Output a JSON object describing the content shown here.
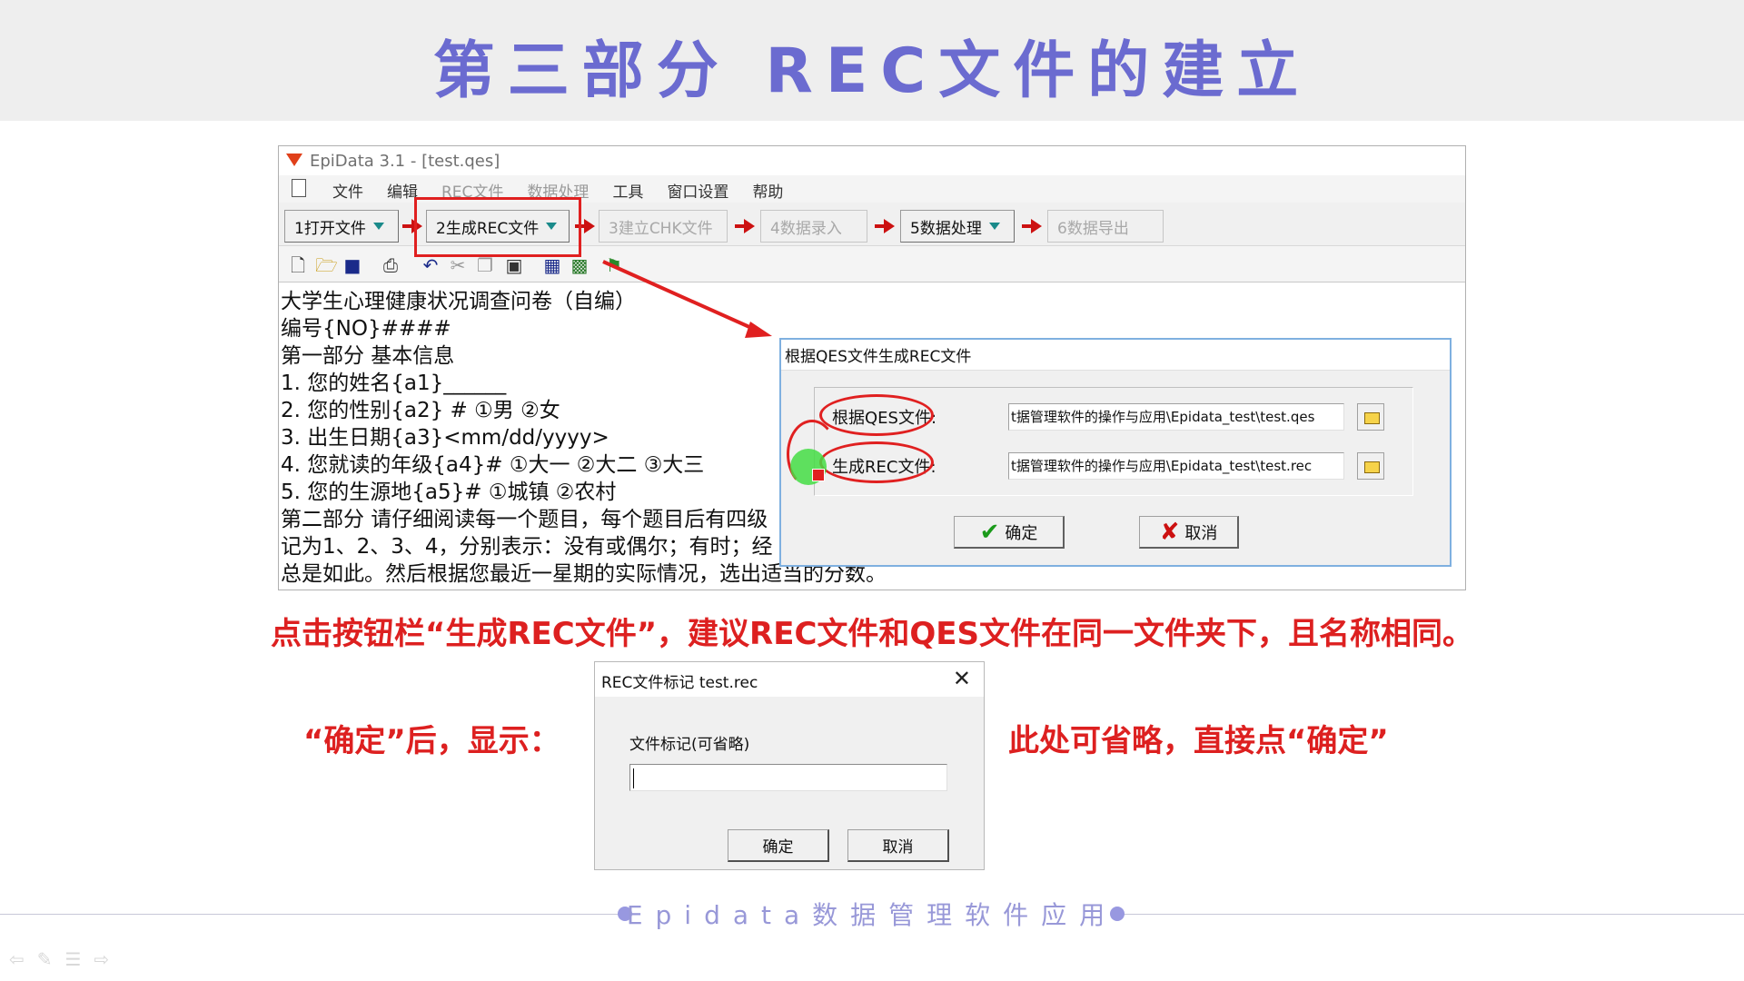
{
  "slide": {
    "title": "第三部分 REC文件的建立",
    "instruction_main": "点击按钮栏“生成REC文件”，建议REC文件和QES文件在同一文件夹下，且名称相同。",
    "instruction_left": "“确定”后，显示：",
    "instruction_right": "此处可省略，直接点“确定”",
    "footer": "Epidata数据管理软件应用",
    "accent_color": "#6b6bd0",
    "highlight_color": "#dd2020"
  },
  "epidata": {
    "title": "EpiData 3.1 - [test.qes]",
    "menu": [
      {
        "label": "文件",
        "enabled": true
      },
      {
        "label": "编辑",
        "enabled": true
      },
      {
        "label": "REC文件",
        "enabled": false
      },
      {
        "label": "数据处理",
        "enabled": false
      },
      {
        "label": "工具",
        "enabled": true
      },
      {
        "label": "窗口设置",
        "enabled": true
      },
      {
        "label": "帮助",
        "enabled": true
      }
    ],
    "wizard": [
      {
        "label": "1打开文件",
        "enabled": true,
        "dropdown": true
      },
      {
        "label": "2生成REC文件",
        "enabled": true,
        "dropdown": true
      },
      {
        "label": "3建立CHK文件",
        "enabled": false,
        "dropdown": false
      },
      {
        "label": "4数据录入",
        "enabled": false,
        "dropdown": false
      },
      {
        "label": "5数据处理",
        "enabled": true,
        "dropdown": true
      },
      {
        "label": "6数据导出",
        "enabled": false,
        "dropdown": false
      }
    ],
    "toolbar_icons": [
      "new-file-icon",
      "open-folder-icon",
      "save-icon",
      "print-icon",
      "undo-icon",
      "cut-icon",
      "copy-icon",
      "paste-icon",
      "preview-icon",
      "field-icon",
      "run-icon"
    ],
    "editor_lines": [
      "大学生心理健康状况调查问卷（自编）",
      "编号{NO}####",
      "第一部分 基本信息",
      "1. 您的姓名{a1}______",
      "2. 您的性别{a2} # ①男    ②女",
      "3. 出生日期{a3}<mm/dd/yyyy>",
      "4. 您就读的年级{a4}#  ①大一    ②大二    ③大三",
      "5. 您的生源地{a5}#  ①城镇    ②农村",
      "第二部分 请仔细阅读每一个题目，每个题目后有四级",
      "记为1、2、3、4，分别表示：没有或偶尔；有时；经",
      "总是如此。然后根据您最近一星期的实际情况，选出适当的分数。"
    ]
  },
  "gen_dialog": {
    "title": "根据QES文件生成REC文件",
    "qes_label": "根据QES文件:",
    "rec_label": "生成REC文件:",
    "qes_path": "t据管理软件的操作与应用\\Epidata_test\\test.qes",
    "rec_path": "t据管理软件的操作与应用\\Epidata_test\\test.rec",
    "ok_label": "确定",
    "cancel_label": "取消"
  },
  "tag_dialog": {
    "title": "REC文件标记 test.rec",
    "close_glyph": "✕",
    "field_label": "文件标记(可省略)",
    "field_value": "",
    "ok_label": "确定",
    "cancel_label": "取消"
  }
}
